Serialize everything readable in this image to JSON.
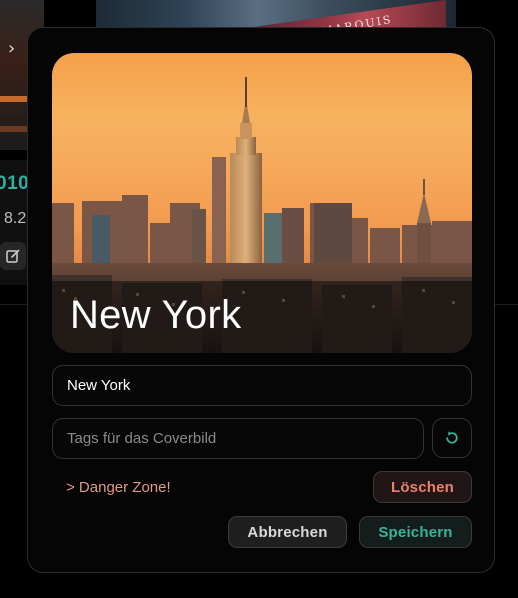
{
  "background": {
    "year_partial": "010",
    "score_partial": "8.2",
    "sign_text": "OTT MARQUIS"
  },
  "modal": {
    "cover": {
      "title": "New York"
    },
    "name_input": {
      "value": "New York"
    },
    "tags_input": {
      "placeholder": "Tags für das Coverbild",
      "value": ""
    },
    "danger_zone_label": "> Danger Zone!",
    "buttons": {
      "delete": "Löschen",
      "cancel": "Abbrechen",
      "save": "Speichern"
    }
  },
  "colors": {
    "accent_teal": "#35b59a",
    "danger": "#e9816b",
    "danger_link": "#e29a82"
  },
  "icons": {
    "refresh": "refresh-icon",
    "edit": "edit-icon",
    "chevron": "chevron-icon"
  }
}
